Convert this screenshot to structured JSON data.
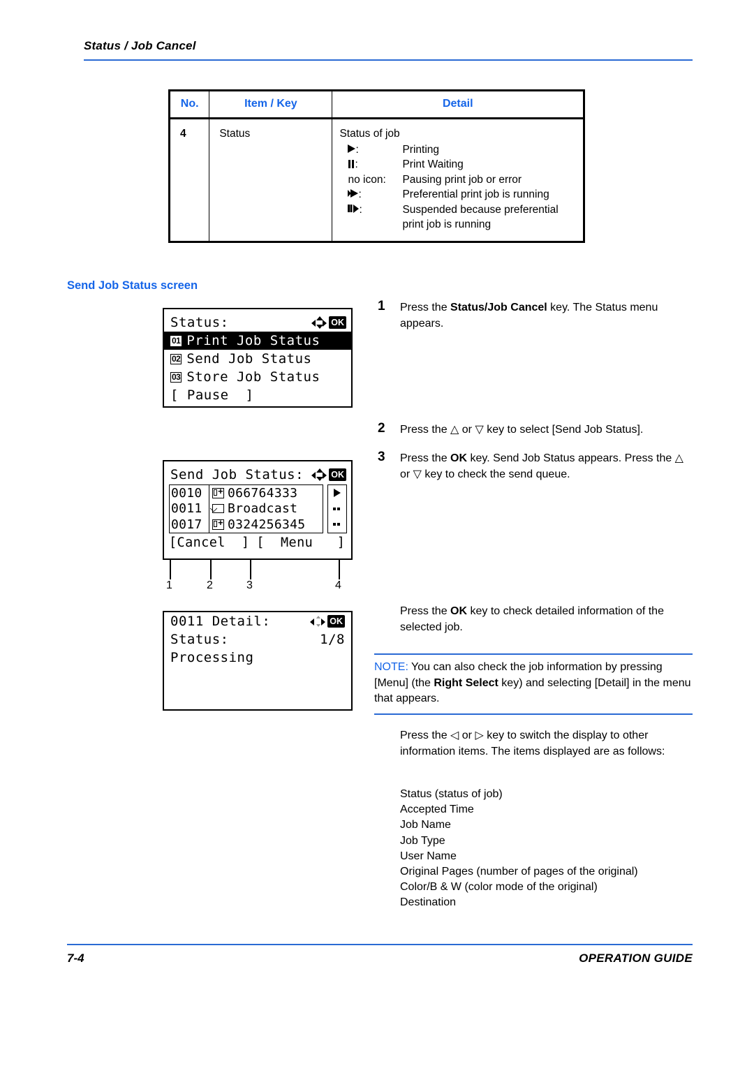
{
  "header": {
    "breadcrumb": "Status / Job Cancel"
  },
  "spec_table": {
    "columns": [
      "No.",
      "Item / Key",
      "Detail"
    ],
    "rows": [
      {
        "no": "4",
        "item": "Status",
        "detail_lead": "Status of job",
        "status_entries": [
          {
            "icon": "printing-triangle-icon",
            "key": ":",
            "value": "Printing"
          },
          {
            "icon": "pause-bars-icon",
            "key": ":",
            "value": "Print Waiting"
          },
          {
            "icon": "none",
            "key": "no icon:",
            "value": "Pausing print job or error"
          },
          {
            "icon": "preferential-triangle-icon",
            "key": ":",
            "value": "Preferential print job is running"
          },
          {
            "icon": "suspended-triangle-icon",
            "key": ":",
            "value": "Suspended because preferential print job is running"
          }
        ]
      }
    ]
  },
  "section_heading": "Send Job Status screen",
  "lcd_status_menu": {
    "title": "Status:",
    "ok_label": "OK",
    "items": [
      {
        "num": "01",
        "label": "Print Job Status",
        "selected": true
      },
      {
        "num": "02",
        "label": "Send Job Status",
        "selected": false
      },
      {
        "num": "03",
        "label": "Store Job Status",
        "selected": false
      }
    ],
    "softkey_left": "[ Pause  ]"
  },
  "lcd_send_job_status": {
    "title": "Send Job Status:",
    "ok_label": "OK",
    "jobs": [
      {
        "id": "0010",
        "icon": "fax-icon",
        "destination": "066764333",
        "status_icon": "printing-triangle-icon"
      },
      {
        "id": "0011",
        "icon": "mail-icon",
        "destination": "Broadcast",
        "status_icon": "dots-icon"
      },
      {
        "id": "0017",
        "icon": "fax-icon",
        "destination": "0324256345",
        "status_icon": "dots-icon"
      }
    ],
    "softkey_left": "[Cancel  ]",
    "softkey_right": "[  Menu   ]",
    "callouts": [
      "1",
      "2",
      "3",
      "4"
    ]
  },
  "lcd_detail": {
    "title": "0011 Detail:",
    "ok_label": "OK",
    "field_label": "Status:",
    "page_indicator": "1/8",
    "field_value": "Processing"
  },
  "steps": [
    {
      "number": "1",
      "parts": [
        {
          "text": "Press the ",
          "bold": false
        },
        {
          "text": "Status/Job Cancel",
          "bold": true
        },
        {
          "text": " key. The Status menu appears.",
          "bold": false
        }
      ]
    },
    {
      "number": "2",
      "parts": [
        {
          "text": "Press the △ or ▽ key to select [Send Job Status].",
          "bold": false
        }
      ]
    },
    {
      "number": "3",
      "parts": [
        {
          "text": "Press the ",
          "bold": false
        },
        {
          "text": "OK",
          "bold": true
        },
        {
          "text": " key. Send Job Status appears. Press the △ or ▽ key to check the send queue.",
          "bold": false
        }
      ]
    }
  ],
  "paragraph_ok": {
    "parts": [
      {
        "text": "Press the ",
        "bold": false
      },
      {
        "text": "OK",
        "bold": true
      },
      {
        "text": " key to check detailed information of the selected job.",
        "bold": false
      }
    ]
  },
  "note": {
    "label": "NOTE:",
    "parts": [
      {
        "text": " You can also check the job information by pressing [Menu] (the ",
        "bold": false
      },
      {
        "text": "Right Select",
        "bold": true
      },
      {
        "text": " key) and selecting [Detail] in the menu that appears.",
        "bold": false
      }
    ]
  },
  "paragraph_leftright": {
    "text": "Press the ◁ or ▷ key to switch the display to other information items. The items displayed are as follows:"
  },
  "info_items": [
    "Status (status of job)",
    "Accepted Time",
    "Job Name",
    "Job Type",
    "User Name",
    "Original Pages (number of pages of the original)",
    "Color/B & W (color mode of the original)",
    "Destination"
  ],
  "footer": {
    "page_number": "7-4",
    "guide_label": "OPERATION GUIDE"
  },
  "colors": {
    "accent_blue": "#1565e8",
    "rule_blue": "#2a6ad4",
    "text": "#000000"
  }
}
